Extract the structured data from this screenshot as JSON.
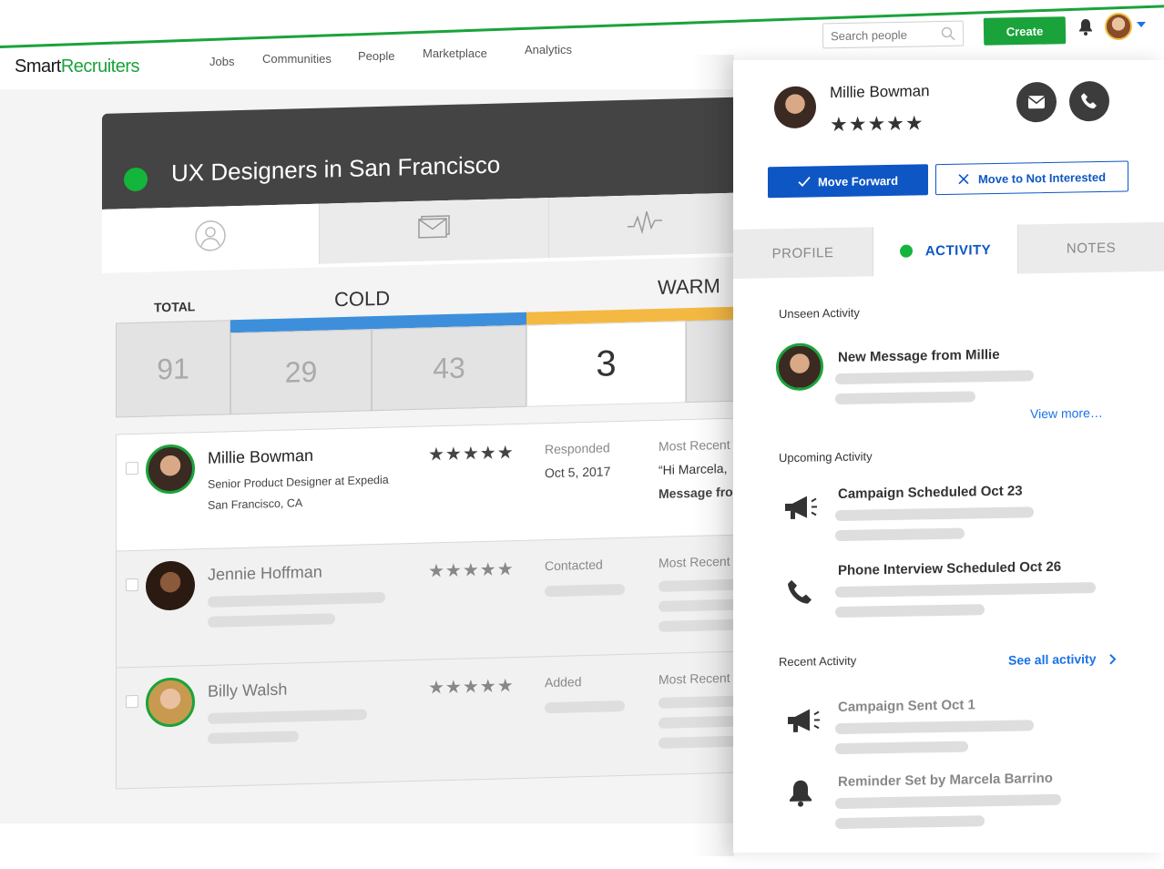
{
  "brand": {
    "name_strong": "Smart",
    "name_light": "Recruiters"
  },
  "nav": {
    "items": [
      "Jobs",
      "Communities",
      "People",
      "Marketplace",
      "Analytics"
    ]
  },
  "search": {
    "placeholder": "Search people"
  },
  "toolbar": {
    "create_label": "Create"
  },
  "pipeline": {
    "title": "UX Designers in San Francisco",
    "stage_labels": {
      "total": "TOTAL",
      "cold": "COLD",
      "warm": "WARM"
    },
    "counts": [
      "91",
      "29",
      "43",
      "3"
    ]
  },
  "candidates": [
    {
      "name": "Millie Bowman",
      "title": "Senior Product Designer at Expedia",
      "location": "San Francisco, CA",
      "rating": "★★★★★",
      "status": "Responded",
      "date": "Oct 5, 2017",
      "most_recent_label": "Most Recent",
      "quote": "“Hi Marcela,",
      "message": "Message fro"
    },
    {
      "name": "Jennie Hoffman",
      "rating": "★★★★★",
      "status": "Contacted",
      "most_recent_label": "Most Recent"
    },
    {
      "name": "Billy Walsh",
      "rating": "★★★★★",
      "status": "Added",
      "most_recent_label": "Most Recent"
    }
  ],
  "profile": {
    "name": "Millie Bowman",
    "rating": "★★★★★",
    "move_forward_label": "Move Forward",
    "not_interested_label": "Move to Not Interested",
    "tabs": [
      "PROFILE",
      "ACTIVITY",
      "NOTES"
    ],
    "active_tab": "ACTIVITY"
  },
  "activity": {
    "unseen_heading": "Unseen Activity",
    "unseen_items": [
      {
        "title": "New Message from Millie"
      }
    ],
    "view_more_label": "View more…",
    "upcoming_heading": "Upcoming Activity",
    "upcoming_items": [
      {
        "title": "Campaign Scheduled Oct 23",
        "icon": "megaphone-icon"
      },
      {
        "title": "Phone Interview Scheduled Oct 26",
        "icon": "phone-icon"
      }
    ],
    "recent_heading": "Recent Activity",
    "see_all_label": "See all activity",
    "recent_items": [
      {
        "title": "Campaign Sent Oct 1",
        "icon": "megaphone-icon"
      },
      {
        "title": "Reminder Set by Marcela Barrino",
        "icon": "bell-icon"
      }
    ]
  },
  "colors": {
    "brand_green": "#1aa33a",
    "status_green": "#13b53b",
    "primary_blue": "#0d56c4",
    "cold_blue": "#3d8fdb",
    "warm_yellow": "#f4b942"
  }
}
